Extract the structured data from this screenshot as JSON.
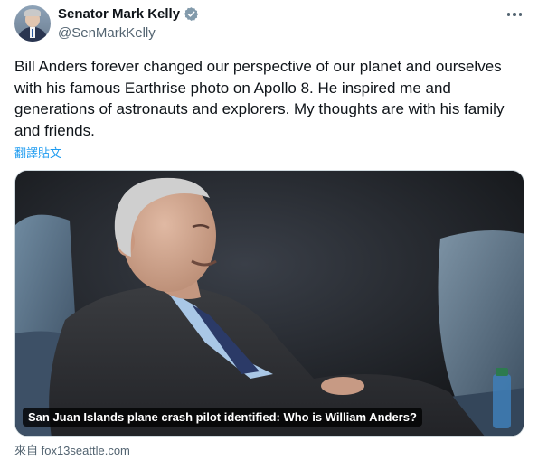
{
  "author": {
    "display_name": "Senator Mark Kelly",
    "handle": "@SenMarkKelly",
    "avatar_icon": "profile-photo",
    "verified_icon": "verified-badge-icon"
  },
  "more_icon": "more-dots-icon",
  "tweet": {
    "text": "Bill Anders forever changed our perspective of our planet and ourselves with his famous Earthrise photo on Apollo 8. He inspired me and generations of astronauts and explorers. My thoughts are with his family and friends.",
    "translate_label": "翻譯貼文"
  },
  "link_card": {
    "caption": "San Juan Islands plane crash pilot identified: Who is William Anders?",
    "source": "來自 fox13seattle.com"
  },
  "colors": {
    "accent": "#1d9bf0",
    "secondary_text": "#536471",
    "primary_text": "#0f1419"
  }
}
